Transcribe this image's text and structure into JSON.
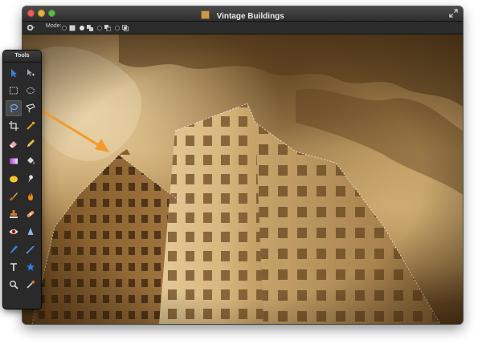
{
  "window": {
    "title": "Vintage Buildings",
    "doc_icon": "document-image-icon",
    "fullscreen_icon": "fullscreen-icon"
  },
  "options_bar": {
    "settings_icon": "gear-icon",
    "mode_label": "Mode:",
    "modes": [
      {
        "icon": "new-selection-icon",
        "selected": false
      },
      {
        "icon": "add-to-selection-icon",
        "selected": true
      },
      {
        "icon": "subtract-selection-icon",
        "selected": false
      },
      {
        "icon": "intersect-selection-icon",
        "selected": false
      }
    ]
  },
  "tools_panel": {
    "title": "Tools",
    "tools": [
      {
        "name": "move-tool",
        "icon": "move-arrow-icon",
        "active": false
      },
      {
        "name": "direct-selection-tool",
        "icon": "direct-select-icon",
        "active": false
      },
      {
        "name": "rectangular-marquee-tool",
        "icon": "rect-marquee-icon",
        "active": false
      },
      {
        "name": "elliptical-marquee-tool",
        "icon": "ellipse-marquee-icon",
        "active": false
      },
      {
        "name": "lasso-tool",
        "icon": "lasso-icon",
        "active": true
      },
      {
        "name": "polygon-lasso-tool",
        "icon": "polygon-lasso-icon",
        "active": false
      },
      {
        "name": "crop-tool",
        "icon": "crop-icon",
        "active": false
      },
      {
        "name": "eyedropper-tool",
        "icon": "eyedropper-icon",
        "active": false
      },
      {
        "name": "eraser-tool",
        "icon": "eraser-icon",
        "active": false
      },
      {
        "name": "pencil-tool",
        "icon": "pencil-icon",
        "active": false
      },
      {
        "name": "gradient-tool",
        "icon": "gradient-icon",
        "active": false
      },
      {
        "name": "paint-bucket-tool",
        "icon": "paint-bucket-icon",
        "active": false
      },
      {
        "name": "color-fill-tool",
        "icon": "color-fill-icon",
        "active": false
      },
      {
        "name": "smudge-tool",
        "icon": "smudge-icon",
        "active": false
      },
      {
        "name": "brush-tool",
        "icon": "brush-icon",
        "active": false
      },
      {
        "name": "burn-tool",
        "icon": "burn-icon",
        "active": false
      },
      {
        "name": "clone-stamp-tool",
        "icon": "stamp-icon",
        "active": false
      },
      {
        "name": "healing-tool",
        "icon": "bandage-icon",
        "active": false
      },
      {
        "name": "red-eye-tool",
        "icon": "eye-icon",
        "active": false
      },
      {
        "name": "sharpen-tool",
        "icon": "sharpen-drop-icon",
        "active": false
      },
      {
        "name": "pen-tool",
        "icon": "pen-icon",
        "active": false
      },
      {
        "name": "line-tool",
        "icon": "line-icon",
        "active": false
      },
      {
        "name": "type-tool",
        "icon": "type-t-icon",
        "active": false
      },
      {
        "name": "shape-tool",
        "icon": "star-icon",
        "active": false
      },
      {
        "name": "zoom-tool",
        "icon": "magnifier-icon",
        "active": false
      },
      {
        "name": "color-picker-tool",
        "icon": "dropper-icon",
        "active": false
      }
    ]
  },
  "canvas": {
    "image": "vintage-buildings-photo",
    "annotation": "orange-arrow-pointer"
  }
}
